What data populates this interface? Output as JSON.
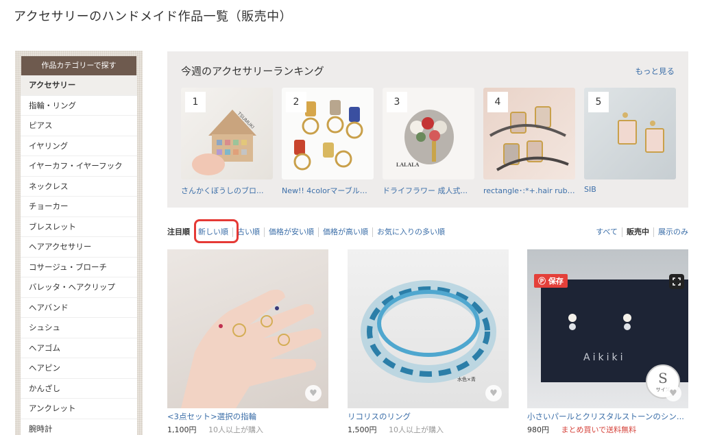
{
  "page": {
    "title": "アクセサリーのハンドメイド作品一覧（販売中）"
  },
  "sidebar": {
    "header": "作品カテゴリーで探す",
    "items": [
      {
        "label": "アクセサリー"
      },
      {
        "label": "指輪・リング"
      },
      {
        "label": "ピアス"
      },
      {
        "label": "イヤリング"
      },
      {
        "label": "イヤーカフ・イヤーフック"
      },
      {
        "label": "ネックレス"
      },
      {
        "label": "チョーカー"
      },
      {
        "label": "ブレスレット"
      },
      {
        "label": "ヘアアクセサリー"
      },
      {
        "label": "コサージュ・ブローチ"
      },
      {
        "label": "バレッタ・ヘアクリップ"
      },
      {
        "label": "ヘアバンド"
      },
      {
        "label": "シュシュ"
      },
      {
        "label": "ヘアゴム"
      },
      {
        "label": "ヘアピン"
      },
      {
        "label": "かんざし"
      },
      {
        "label": "アンクレット"
      },
      {
        "label": "腕時計"
      }
    ]
  },
  "ranking": {
    "title": "今週のアクセサリーランキング",
    "more": "もっと見る",
    "items": [
      {
        "rank": "1",
        "caption": "さんかくぼうしのブロ..."
      },
      {
        "rank": "2",
        "caption": "New!! 4colorマーブル長..."
      },
      {
        "rank": "3",
        "caption": "ドライフラワー 成人式..."
      },
      {
        "rank": "4",
        "caption": "rectangle･:*+.hair rubber"
      },
      {
        "rank": "5",
        "caption": "SIB"
      }
    ],
    "image_texts": {
      "tsumuki": "TSUMUKI",
      "lalala": "LALALA"
    }
  },
  "sort": {
    "options": [
      "注目順",
      "新しい順",
      "古い順",
      "価格が安い順",
      "価格が高い順",
      "お気に入りの多い順"
    ],
    "filters": [
      "すべて",
      "販売中",
      "展示のみ"
    ]
  },
  "products": [
    {
      "name": "<3点セット>選択の指輪",
      "price": "1,100円",
      "note": "10人以上が購入"
    },
    {
      "name": "リコリスのリング",
      "price": "1,500円",
      "note": "10人以上が購入",
      "image_caption": "水色×青"
    },
    {
      "name": "小さいパールとクリスタルストーンのシン...",
      "price": "980円",
      "note": "まとめ買いで送料無料",
      "save_label": "保存",
      "image_brand": "Aikiki",
      "size_letter": "S",
      "size_label": "サイズ"
    }
  ],
  "colors": {
    "link": "#3b6ea8",
    "sidebar_header": "#6e5a4e",
    "promo": "#d6453d",
    "highlight": "#e53935"
  },
  "icons": [
    "heart-icon",
    "pin-icon",
    "expand-icon"
  ]
}
